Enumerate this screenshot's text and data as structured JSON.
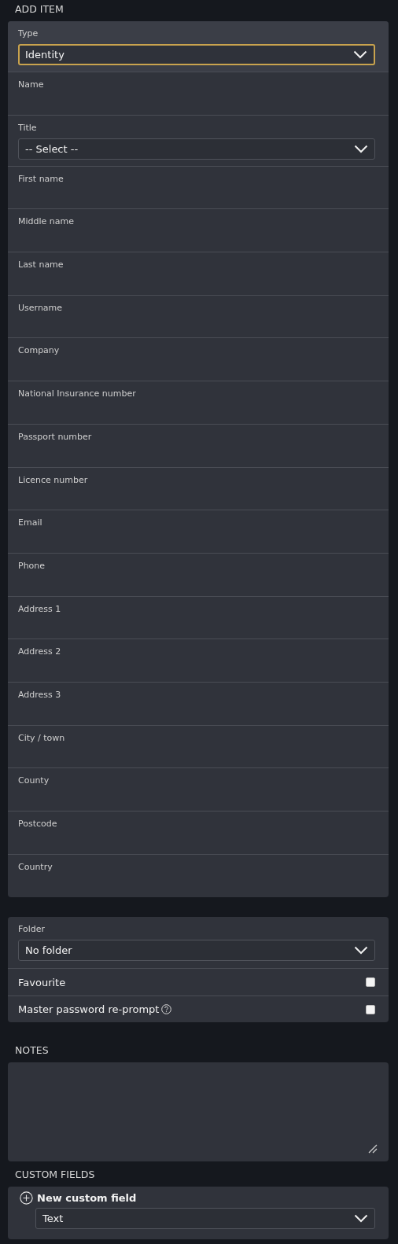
{
  "add_item": {
    "heading": "ADD ITEM",
    "fields": [
      {
        "kind": "select",
        "label": "Type",
        "value": "Identity",
        "focused": true
      },
      {
        "kind": "text",
        "label": "Name"
      },
      {
        "kind": "select",
        "label": "Title",
        "value": "-- Select --",
        "focused": false
      },
      {
        "kind": "text",
        "label": "First name"
      },
      {
        "kind": "text",
        "label": "Middle name"
      },
      {
        "kind": "text",
        "label": "Last name"
      },
      {
        "kind": "text",
        "label": "Username"
      },
      {
        "kind": "text",
        "label": "Company"
      },
      {
        "kind": "text",
        "label": "National Insurance number"
      },
      {
        "kind": "text",
        "label": "Passport number"
      },
      {
        "kind": "text",
        "label": "Licence number"
      },
      {
        "kind": "text",
        "label": "Email"
      },
      {
        "kind": "text",
        "label": "Phone"
      },
      {
        "kind": "text",
        "label": "Address 1"
      },
      {
        "kind": "text",
        "label": "Address 2"
      },
      {
        "kind": "text",
        "label": "Address 3"
      },
      {
        "kind": "text",
        "label": "City / town"
      },
      {
        "kind": "text",
        "label": "County"
      },
      {
        "kind": "text",
        "label": "Postcode"
      },
      {
        "kind": "text",
        "label": "Country"
      }
    ]
  },
  "options": {
    "folder": {
      "label": "Folder",
      "value": "No folder"
    },
    "checks": [
      {
        "label": "Favourite",
        "checked": false,
        "help": false
      },
      {
        "label": "Master password re-prompt",
        "checked": false,
        "help": true
      }
    ]
  },
  "notes": {
    "heading": "NOTES"
  },
  "custom_fields": {
    "heading": "CUSTOM FIELDS",
    "button": "New custom field",
    "type_value": "Text"
  }
}
